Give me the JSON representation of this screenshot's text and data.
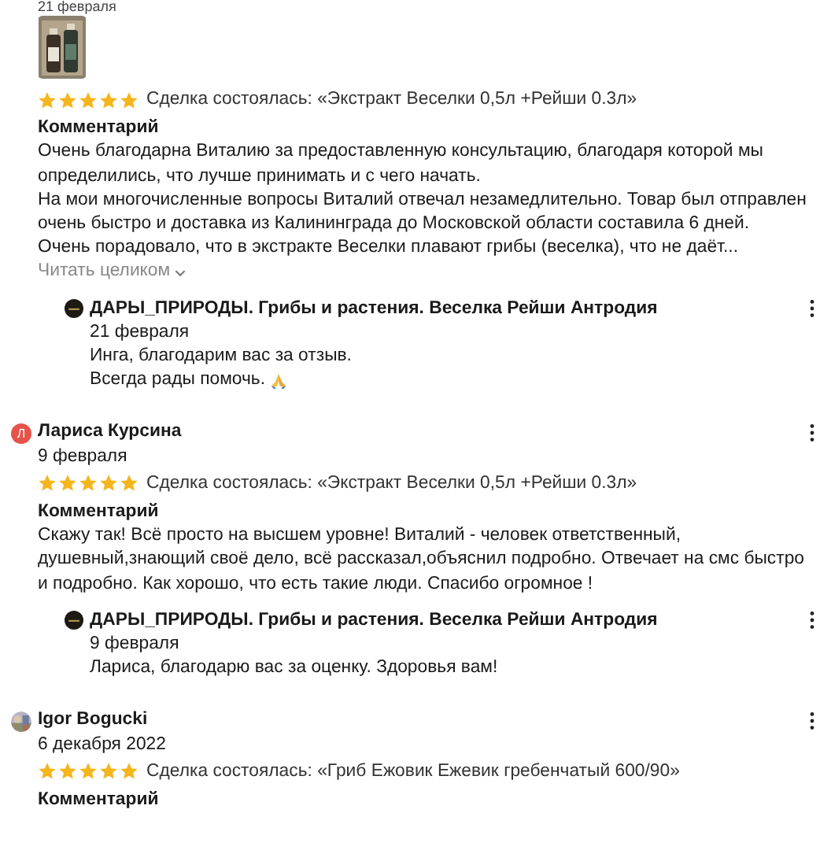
{
  "top_date": "21 февраля",
  "reviews": [
    {
      "photos": [
        {
          "kind": "picture"
        }
      ],
      "stars": 5,
      "deal": "Сделка состоялась: «Экстракт Веселки 0,5л +Рейши 0.3л»",
      "comment_title": "Комментарий",
      "comment": [
        "Очень благодарна Виталию за предоставленную консультацию, благодаря которой мы определились, что лучше принимать и с чего начать.",
        "На мои многочисленные вопросы Виталий отвечал незамедлительно. Товар был отправлен очень быстро и доставка из Калининграда до Московской области составила 6 дней.",
        "Очень порадовало, что в экстракте Веселки плавают грибы (веселка), что не даёт..."
      ],
      "read_more": "Читать целиком",
      "reply": {
        "shop": "ДАРЫ_ПРИРОДЫ. Грибы и растения. Веселка Рейши Антродия",
        "date": "21 февраля",
        "lines": [
          {
            "text": "Инга, благодарим вас за отзыв.",
            "emoji": false
          },
          {
            "text": "Всегда рады помочь.",
            "emoji": true
          }
        ]
      }
    },
    {
      "author": {
        "name": "Лариса Курсина",
        "avatar": {
          "kind": "letter",
          "letter": "Л",
          "color": "#e5534b"
        }
      },
      "date": "9 февраля",
      "stars": 5,
      "deal": "Сделка состоялась: «Экстракт Веселки 0,5л +Рейши 0.3л»",
      "comment_title": "Комментарий",
      "comment": [
        "Скажу так! Всё просто на высшем уровне! Виталий - человек ответственный, душевный,знающий своё дело, всё рассказал,объяснил подробно. Отвечает на смс быстро и подробно. Как хорошо, что есть такие люди. Спасибо огромное !"
      ],
      "reply": {
        "shop": "ДАРЫ_ПРИРОДЫ. Грибы и растения. Веселка Рейши Антродия",
        "date": "9 февраля",
        "lines": [
          {
            "text": "Лариса, благодарю вас за оценку. Здоровья вам!",
            "emoji": false
          }
        ]
      }
    },
    {
      "author": {
        "name": "Igor Bogucki",
        "avatar": {
          "kind": "picture"
        }
      },
      "date": "6 декабря 2022",
      "stars": 5,
      "deal": "Сделка состоялась: «Гриб Ежовик Ежевик гребенчатый 600/90»",
      "comment_title": "Комментарий"
    }
  ]
}
